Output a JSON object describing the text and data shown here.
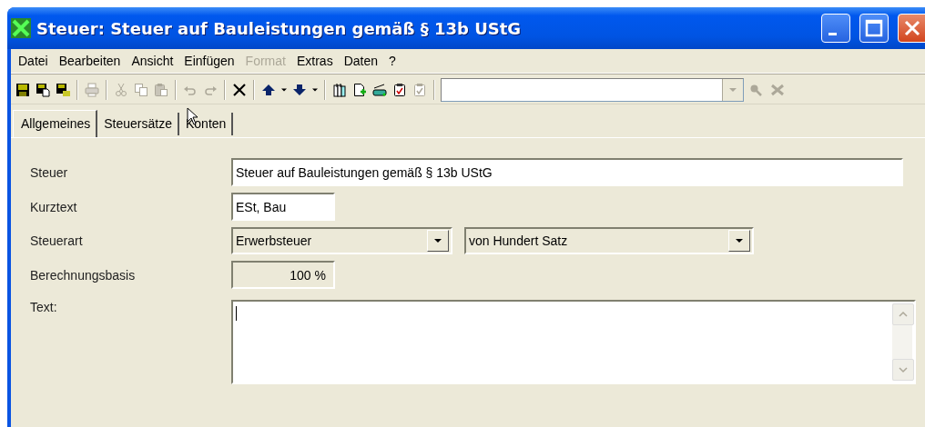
{
  "window": {
    "title": "Steuer: Steuer auf Bauleistungen gemäß § 13b UStG"
  },
  "menu": [
    {
      "label": "Datei",
      "disabled": false
    },
    {
      "label": "Bearbeiten",
      "disabled": false
    },
    {
      "label": "Ansicht",
      "disabled": false
    },
    {
      "label": "Einfügen",
      "disabled": false
    },
    {
      "label": "Format",
      "disabled": true
    },
    {
      "label": "Extras",
      "disabled": false
    },
    {
      "label": "Daten",
      "disabled": false
    },
    {
      "label": "?",
      "disabled": false
    }
  ],
  "toolbar": {
    "buttons": [
      {
        "disabled": false
      },
      {
        "disabled": false
      },
      {
        "disabled": false
      },
      {
        "disabled": true
      },
      {
        "disabled": true
      },
      {
        "disabled": true
      },
      {
        "disabled": true
      },
      {
        "disabled": true
      },
      {
        "disabled": true
      },
      {
        "disabled": false
      },
      {
        "disabled": false
      },
      {
        "disabled": false
      },
      {
        "disabled": false
      },
      {
        "disabled": false
      },
      {
        "disabled": false
      },
      {
        "disabled": false
      },
      {
        "disabled": false
      },
      {
        "disabled": false
      },
      {
        "disabled": true
      }
    ],
    "search_buttons": [
      {
        "disabled": true
      },
      {
        "disabled": true
      }
    ]
  },
  "tabs": [
    {
      "label": "Allgemeines",
      "selected": true
    },
    {
      "label": "Steuersätze",
      "selected": false
    },
    {
      "label": "Konten",
      "selected": false
    }
  ],
  "form": [
    {
      "label": "Steuer",
      "kind": "text",
      "value": "Steuer auf Bauleistungen gemäß § 13b UStG"
    },
    {
      "label": "Kurztext",
      "kind": "text",
      "value": "ESt, Bau"
    },
    {
      "label": "Steuerart",
      "kind": "selects",
      "values": [
        "Erwerbsteuer",
        "von Hundert Satz"
      ]
    },
    {
      "label": "Berechnungsbasis",
      "kind": "readonly",
      "value": "100 %"
    },
    {
      "label": "Text:",
      "kind": "textarea"
    }
  ]
}
